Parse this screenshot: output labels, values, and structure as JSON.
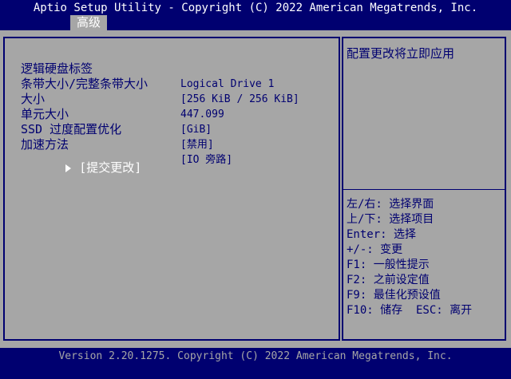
{
  "header": {
    "title": "Aptio Setup Utility - Copyright (C) 2022 American Megatrends, Inc.",
    "active_tab": "高级"
  },
  "settings": [
    {
      "label": "逻辑硬盘标签",
      "value": "Logical Drive 1"
    },
    {
      "label": "条带大小/完整条带大小",
      "value": "[256 KiB / 256 KiB]"
    },
    {
      "label": "大小",
      "value": "447.099"
    },
    {
      "label": "单元大小",
      "value": "[GiB]"
    },
    {
      "label": "SSD 过度配置优化",
      "value": "[禁用]"
    },
    {
      "label": "加速方法",
      "value": "[IO 旁路]"
    }
  ],
  "submit": {
    "label": "[提交更改]"
  },
  "help": {
    "description": "配置更改将立即应用"
  },
  "keys": [
    "左/右: 选择界面",
    "上/下: 选择项目",
    "Enter: 选择",
    "+/-: 变更",
    "F1: 一般性提示",
    "F2: 之前设定值",
    "F9: 最佳化预设值",
    "F10: 储存  ESC: 离开"
  ],
  "footer": {
    "version": "Version 2.20.1275. Copyright (C) 2022 American Megatrends, Inc."
  },
  "colors": {
    "background_blue": "#000070",
    "panel_gray": "#a6a6a6",
    "selected_text": "#ffffff"
  }
}
